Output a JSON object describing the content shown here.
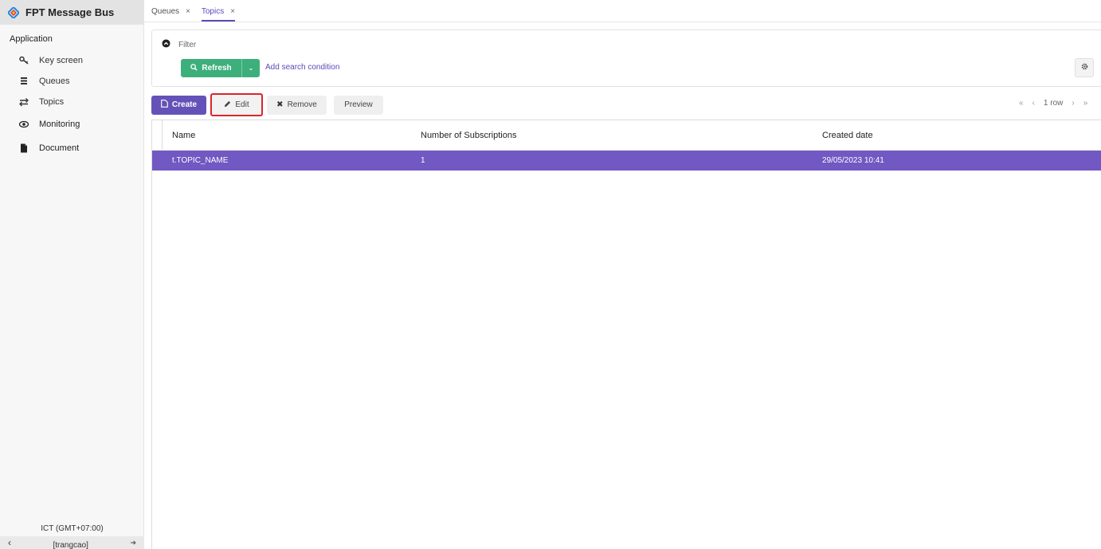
{
  "app": {
    "title": "FPT Message Bus",
    "logo_icon": "diamond-logo-icon",
    "brand_colors": [
      "#1e88e5",
      "#e53935",
      "#fbc02d"
    ]
  },
  "sidebar": {
    "section_label": "Application",
    "items": [
      {
        "label": "Key screen",
        "icon": "key-icon"
      },
      {
        "label": "Queues",
        "icon": "list-icon"
      },
      {
        "label": "Topics",
        "icon": "arrows-icon"
      },
      {
        "label": "Monitoring",
        "icon": "eye-icon"
      },
      {
        "label": "Document",
        "icon": "document-icon"
      }
    ],
    "timezone": "ICT (GMT+07:00)",
    "user": "[trangcao]"
  },
  "tabs": [
    {
      "label": "Queues",
      "close": "×",
      "active": false
    },
    {
      "label": "Topics",
      "close": "×",
      "active": true
    }
  ],
  "filter": {
    "label": "Filter",
    "refresh_label": "Refresh",
    "add_condition_label": "Add search condition"
  },
  "toolbar": {
    "create_label": "Create",
    "edit_label": "Edit",
    "remove_label": "Remove",
    "preview_label": "Preview"
  },
  "pager": {
    "first": "«",
    "prev": "‹",
    "rows": "1 row",
    "next": "›",
    "last": "»"
  },
  "table": {
    "columns": [
      "Name",
      "Number of Subscriptions",
      "Created date"
    ],
    "rows": [
      {
        "name": "t.TOPIC_NAME",
        "subscriptions": "1",
        "created": "29/05/2023 10:41"
      }
    ]
  },
  "colors": {
    "primary": "#6552b8",
    "selected_row": "#7158c2",
    "refresh": "#3daf7b",
    "highlight_border": "#d9262b"
  }
}
